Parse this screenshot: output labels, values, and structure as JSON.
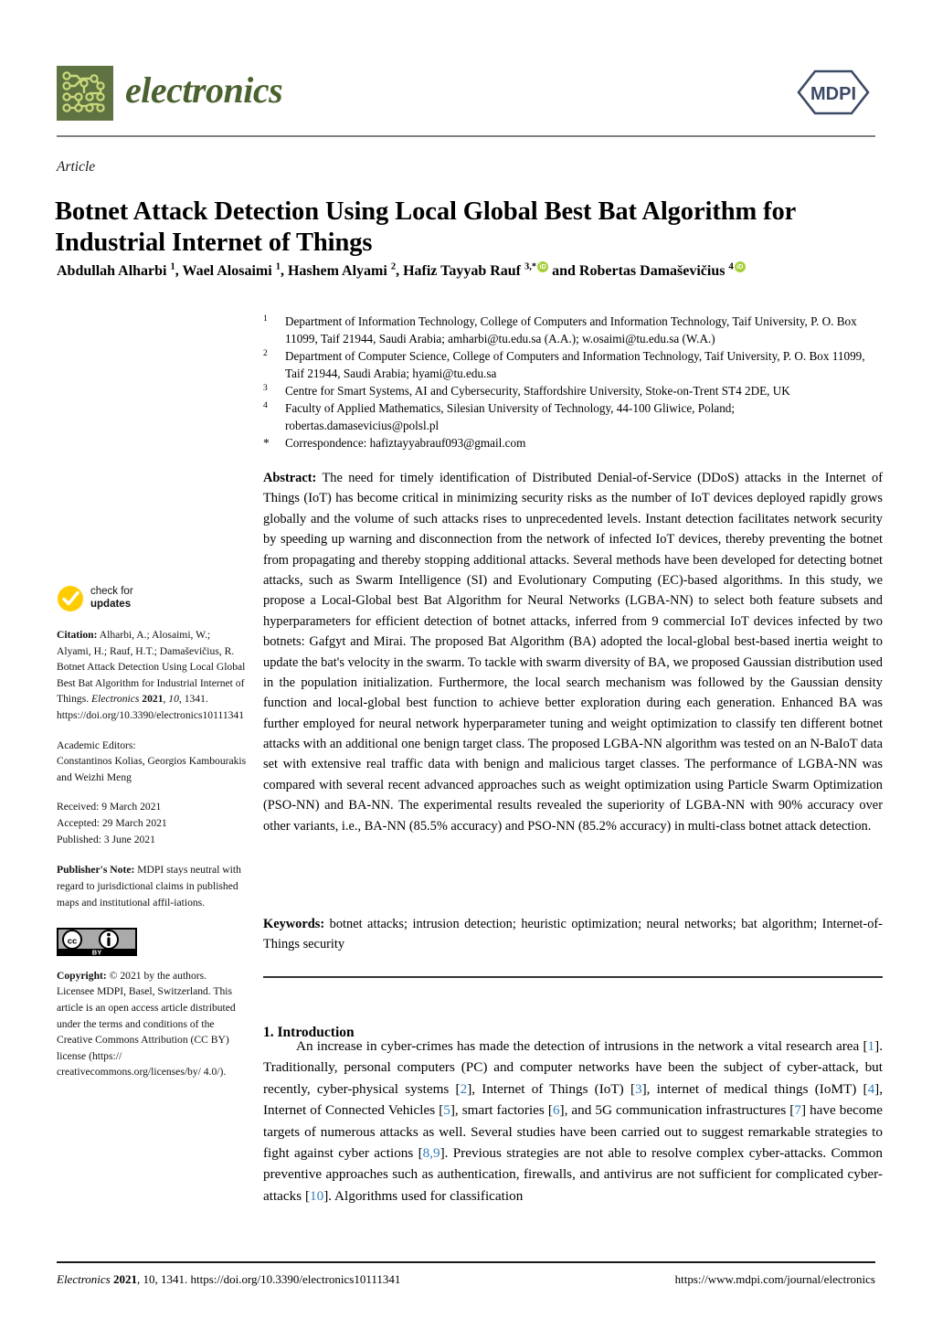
{
  "header": {
    "journal_name": "electronics",
    "publisher_logo_text": "MDPI",
    "logo_icon": "circuit-board-icon",
    "logo_color": "#5f7241",
    "logo_trace_color": "#c9d97a",
    "mdpi_color": "#3d4a66"
  },
  "article": {
    "type": "Article",
    "title": "Botnet Attack Detection Using Local Global Best Bat Algorithm for Industrial Internet of Things",
    "authors_html": "Abdullah Alharbi <sup>1</sup>, Wael Alosaimi <sup>1</sup>, Hashem Alyami <sup>2</sup>, Hafiz Tayyab Rauf <sup>3,*</sup><ORCID> and Robertas Damaševičius <sup>4</sup><ORCID>",
    "authors_plain": "Abdullah Alharbi 1, Wael Alosaimi 1, Hashem Alyami 2, Hafiz Tayyab Rauf 3,* and Robertas Damaševičius 4"
  },
  "affiliations": [
    {
      "marker": "1",
      "text": "Department of Information Technology, College of Computers and Information Technology, Taif University, P. O. Box 11099, Taif 21944, Saudi Arabia; amharbi@tu.edu.sa (A.A.); w.osaimi@tu.edu.sa (W.A.)"
    },
    {
      "marker": "2",
      "text": "Department of Computer Science, College of Computers and Information Technology, Taif University, P. O. Box 11099, Taif 21944, Saudi Arabia; hyami@tu.edu.sa"
    },
    {
      "marker": "3",
      "text": "Centre for Smart Systems, AI and Cybersecurity, Staffordshire University, Stoke-on-Trent ST4 2DE, UK"
    },
    {
      "marker": "4",
      "text": "Faculty of Applied Mathematics, Silesian University of Technology, 44-100 Gliwice, Poland; robertas.damasevicius@polsl.pl"
    },
    {
      "marker": "*",
      "text": "Correspondence: hafiztayyabrauf093@gmail.com"
    }
  ],
  "abstract": {
    "label": "Abstract:",
    "text": "The need for timely identification of Distributed Denial-of-Service (DDoS) attacks in the Internet of Things (IoT) has become critical in minimizing security risks as the number of IoT devices deployed rapidly grows globally and the volume of such attacks rises to unprecedented levels. Instant detection facilitates network security by speeding up warning and disconnection from the network of infected IoT devices, thereby preventing the botnet from propagating and thereby stopping additional attacks. Several methods have been developed for detecting botnet attacks, such as Swarm Intelligence (SI) and Evolutionary Computing (EC)-based algorithms. In this study, we propose a Local-Global best Bat Algorithm for Neural Networks (LGBA-NN) to select both feature subsets and hyperparameters for efficient detection of botnet attacks, inferred from 9 commercial IoT devices infected by two botnets: Gafgyt and Mirai. The proposed Bat Algorithm (BA) adopted the local-global best-based inertia weight to update the bat's velocity in the swarm. To tackle with swarm diversity of BA, we proposed Gaussian distribution used in the population initialization. Furthermore, the local search mechanism was followed by the Gaussian density function and local-global best function to achieve better exploration during each generation. Enhanced BA was further employed for neural network hyperparameter tuning and weight optimization to classify ten different botnet attacks with an additional one benign target class. The proposed LGBA-NN algorithm was tested on an N-BaIoT data set with extensive real traffic data with benign and malicious target classes. The performance of LGBA-NN was compared with several recent advanced approaches such as weight optimization using Particle Swarm Optimization (PSO-NN) and BA-NN. The experimental results revealed the superiority of LGBA-NN with 90% accuracy over other variants, i.e., BA-NN (85.5% accuracy) and PSO-NN (85.2% accuracy) in multi-class botnet attack detection."
  },
  "keywords": {
    "label": "Keywords:",
    "text": "botnet attacks; intrusion detection; heuristic optimization; neural networks; bat algorithm; Internet-of-Things security"
  },
  "introduction": {
    "heading": "1. Introduction",
    "paragraph_1": "An increase in cyber-crimes has made the detection of intrusions in the network a vital research area [1]. Traditionally, personal computers (PC) and computer networks have been the subject of cyber-attack, but recently, cyber-physical systems [2], Internet of Things (IoT) [3], internet of medical things (IoMT) [4], Internet of Connected Vehicles [5], smart factories [6], and 5G communication infrastructures [7] have become targets of numerous attacks as well. Several studies have been carried out to suggest remarkable strategies to fight against cyber actions [8,9]. Previous strategies are not able to resolve complex cyber-attacks. Common preventive approaches such as authentication, firewalls, and antivirus are not sufficient for complicated cyber-attacks [10]. Algorithms used for classification",
    "reference_numbers": [
      "1",
      "2",
      "3",
      "4",
      "5",
      "6",
      "7",
      "8,9",
      "10"
    ],
    "reference_color": "#2f7fc1"
  },
  "sidebar": {
    "check_for_updates": {
      "line1": "check for",
      "line2": "updates",
      "icon": "check-circle-icon",
      "icon_color": "#ffcc00"
    },
    "citation": {
      "label": "Citation:",
      "text": "Alharbi, A.; Alosaimi, W.; Alyami, H.; Rauf, H.T.; Damaševičius, R. Botnet Attack Detection Using Local Global Best Bat Algorithm for Industrial Internet of Things.",
      "journal": "Electronics",
      "year": "2021",
      "volume": "10",
      "article_number": "1341.",
      "doi": "https://doi.org/10.3390/electronics10111341"
    },
    "academic_editors": {
      "label": "Academic Editors:",
      "names": "Constantinos Kolias, Georgios Kambourakis and Weizhi Meng"
    },
    "dates": {
      "received": "Received: 9 March 2021",
      "accepted": "Accepted: 29 March 2021",
      "published": "Published: 3 June 2021"
    },
    "publishers_note": {
      "label": "Publisher's Note:",
      "text": "MDPI stays neutral with regard to jurisdictional claims in published maps and institutional affil-iations."
    },
    "license_badge": {
      "cc_icon": "creative-commons-icon",
      "by_icon": "attribution-person-icon",
      "by_label": "BY"
    },
    "copyright": {
      "label": "Copyright:",
      "text": "© 2021 by the authors. Licensee MDPI, Basel, Switzerland. This article is an open access article distributed under the terms and conditions of the Creative Commons Attribution (CC BY) license (https:// creativecommons.org/licenses/by/ 4.0/)."
    }
  },
  "footer": {
    "left_journal": "Electronics",
    "left_year": "2021",
    "left_rest": ", 10, 1341. https://doi.org/10.3390/electronics10111341",
    "right": "https://www.mdpi.com/journal/electronics"
  }
}
